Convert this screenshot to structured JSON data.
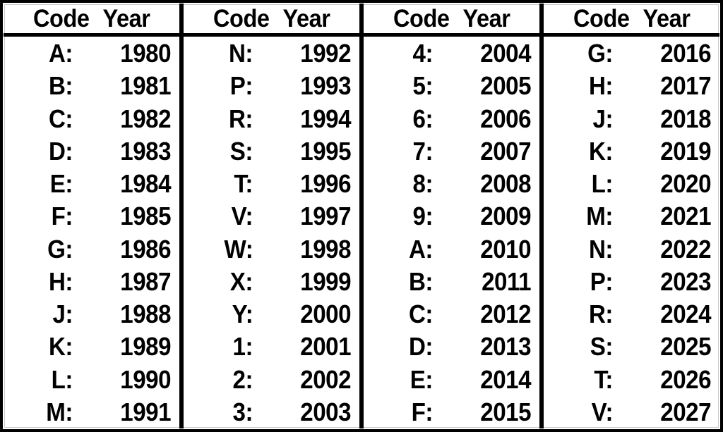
{
  "table": {
    "columns": [
      {
        "header": {
          "code_label": "Code",
          "year_label": "Year"
        },
        "rows": [
          {
            "code": "A:",
            "year": "1980"
          },
          {
            "code": "B:",
            "year": "1981"
          },
          {
            "code": "C:",
            "year": "1982"
          },
          {
            "code": "D:",
            "year": "1983"
          },
          {
            "code": "E:",
            "year": "1984"
          },
          {
            "code": "F:",
            "year": "1985"
          },
          {
            "code": "G:",
            "year": "1986"
          },
          {
            "code": "H:",
            "year": "1987"
          },
          {
            "code": "J:",
            "year": "1988"
          },
          {
            "code": "K:",
            "year": "1989"
          },
          {
            "code": "L:",
            "year": "1990"
          },
          {
            "code": "M:",
            "year": "1991"
          }
        ]
      },
      {
        "header": {
          "code_label": "Code",
          "year_label": "Year"
        },
        "rows": [
          {
            "code": "N:",
            "year": "1992"
          },
          {
            "code": "P:",
            "year": "1993"
          },
          {
            "code": "R:",
            "year": "1994"
          },
          {
            "code": "S:",
            "year": "1995"
          },
          {
            "code": "T:",
            "year": "1996"
          },
          {
            "code": "V:",
            "year": "1997"
          },
          {
            "code": "W:",
            "year": "1998"
          },
          {
            "code": "X:",
            "year": "1999"
          },
          {
            "code": "Y:",
            "year": "2000"
          },
          {
            "code": "1:",
            "year": "2001"
          },
          {
            "code": "2:",
            "year": "2002"
          },
          {
            "code": "3:",
            "year": "2003"
          }
        ]
      },
      {
        "header": {
          "code_label": "Code",
          "year_label": "Year"
        },
        "rows": [
          {
            "code": "4:",
            "year": "2004"
          },
          {
            "code": "5:",
            "year": "2005"
          },
          {
            "code": "6:",
            "year": "2006"
          },
          {
            "code": "7:",
            "year": "2007"
          },
          {
            "code": "8:",
            "year": "2008"
          },
          {
            "code": "9:",
            "year": "2009"
          },
          {
            "code": "A:",
            "year": "2010"
          },
          {
            "code": "B:",
            "year": "2011"
          },
          {
            "code": "C:",
            "year": "2012"
          },
          {
            "code": "D:",
            "year": "2013"
          },
          {
            "code": "E:",
            "year": "2014"
          },
          {
            "code": "F:",
            "year": "2015"
          }
        ]
      },
      {
        "header": {
          "code_label": "Code",
          "year_label": "Year"
        },
        "rows": [
          {
            "code": "G:",
            "year": "2016"
          },
          {
            "code": "H:",
            "year": "2017"
          },
          {
            "code": "J:",
            "year": "2018"
          },
          {
            "code": "K:",
            "year": "2019"
          },
          {
            "code": "L:",
            "year": "2020"
          },
          {
            "code": "M:",
            "year": "2021"
          },
          {
            "code": "N:",
            "year": "2022"
          },
          {
            "code": "P:",
            "year": "2023"
          },
          {
            "code": "R:",
            "year": "2024"
          },
          {
            "code": "S:",
            "year": "2025"
          },
          {
            "code": "T:",
            "year": "2026"
          },
          {
            "code": "V:",
            "year": "2027"
          }
        ]
      }
    ]
  },
  "colors": {
    "ink": "#000000",
    "paper": "#ffffff",
    "hairline": "#c9c9c9"
  }
}
